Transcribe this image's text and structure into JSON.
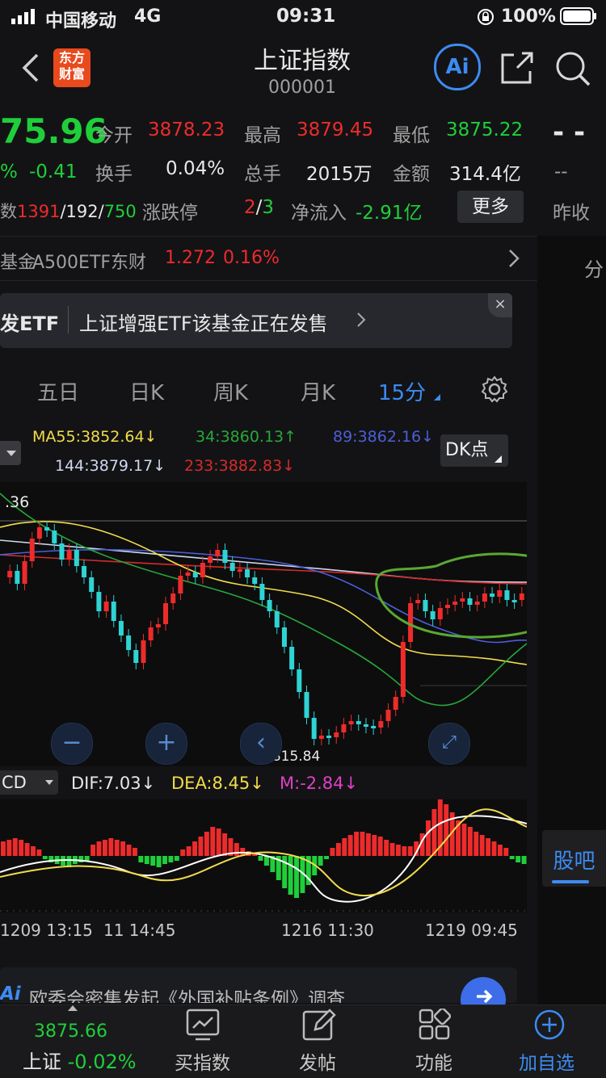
{
  "status": {
    "carrier": "中国移动",
    "network": "4G",
    "time": "09:31",
    "battery": "100%"
  },
  "nav": {
    "logo_line1": "东方",
    "logo_line2": "财富",
    "title": "上证指数",
    "code": "000001",
    "ai_label": "Ai"
  },
  "quote": {
    "price": "75.96",
    "change_pct": "%",
    "change": "-0.41",
    "open_label": "今开",
    "open": "3878.23",
    "high_label": "最高",
    "high": "3879.45",
    "low_label": "最低",
    "low": "3875.22",
    "turnover_label": "换手",
    "turnover": "0.04%",
    "volume_label": "总手",
    "volume": "2015万",
    "amount_label": "金额",
    "amount": "314.4亿",
    "breadth_prefix": "数",
    "breadth_up": "1391",
    "breadth_flat": "/192/",
    "breadth_down": "750",
    "limit_label": "涨跌停",
    "limit_up": "2",
    "limit_sep": "/",
    "limit_down": "3",
    "netflow_label": "净流入",
    "netflow": "-2.91亿",
    "more_label": "更多",
    "side_dash1": "- -",
    "side_dash2": "--",
    "side_prev_close": "昨收"
  },
  "fund": {
    "prefix": "基金",
    "name": "A500ETF东财",
    "price": "1.272",
    "pct": "0.16%",
    "side_label": "分"
  },
  "promo": {
    "tag": "发ETF",
    "text": "上证增强ETF该基金正在发售"
  },
  "tabs": [
    {
      "label": "五日"
    },
    {
      "label": "日K"
    },
    {
      "label": "周K"
    },
    {
      "label": "月K"
    },
    {
      "label": "15分"
    }
  ],
  "ma": {
    "ma55": "MA55:3852.64↓",
    "ma34": "34:3860.13↑",
    "ma89": "89:3862.16↓",
    "ma144": "144:3879.17↓",
    "ma233": "233:3882.83↓",
    "dk_label": "DK点",
    "axis_label": ".36",
    "low_marker": "3815.84"
  },
  "macd": {
    "indicator": "CD",
    "dif": "DIF:7.03↓",
    "dea": "DEA:8.45↓",
    "m": "M:-2.84↓"
  },
  "xaxis": [
    "1209 13:15",
    "11 14:45",
    "1216 11:30",
    "1219 09:45"
  ],
  "news": {
    "ai": "Ai",
    "text": "欧委会密集发起《外国补贴条例》调查"
  },
  "guba": "股吧",
  "bottom": {
    "index_price": "3875.66",
    "index_name": "上证",
    "index_pct": "-0.02%",
    "buy_index": "买指数",
    "post": "发帖",
    "functions": "功能",
    "add_watch": "加自选"
  },
  "colors": {
    "up": "#ee2b2b",
    "down": "#1fcf3a",
    "accent": "#3d8bf2",
    "ma55": "#f2dc4b",
    "ma34": "#28a83a",
    "ma89": "#4a5fd8",
    "ma144": "#cfd8f0",
    "ma233": "#d62a2a"
  }
}
